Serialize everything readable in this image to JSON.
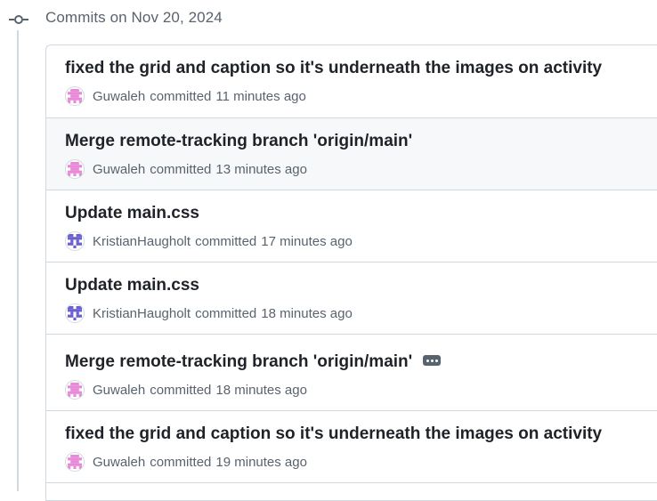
{
  "group": {
    "date_label": "Commits on Nov 20, 2024"
  },
  "colors": {
    "guwaleh_avatar": "#e88ad8",
    "kristian_avatar": "#6a60d0",
    "muted": "#59636e",
    "border": "#d1d9e0"
  },
  "commits": [
    {
      "title": "fixed the grid and caption so it's underneath the images on activity",
      "author": "Guwaleh",
      "action": "committed",
      "time": "11 minutes ago",
      "avatar_icon": "guwaleh-identicon",
      "has_ellipsis": false
    },
    {
      "title": "Merge remote-tracking branch 'origin/main'",
      "author": "Guwaleh",
      "action": "committed",
      "time": "13 minutes ago",
      "avatar_icon": "guwaleh-identicon",
      "has_ellipsis": false
    },
    {
      "title": "Update main.css",
      "author": "KristianHaugholt",
      "action": "committed",
      "time": "17 minutes ago",
      "avatar_icon": "kristian-identicon",
      "has_ellipsis": false
    },
    {
      "title": "Update main.css",
      "author": "KristianHaugholt",
      "action": "committed",
      "time": "18 minutes ago",
      "avatar_icon": "kristian-identicon",
      "has_ellipsis": false
    },
    {
      "title": "Merge remote-tracking branch 'origin/main'",
      "author": "Guwaleh",
      "action": "committed",
      "time": "18 minutes ago",
      "avatar_icon": "guwaleh-identicon",
      "has_ellipsis": true
    },
    {
      "title": "fixed the grid and caption so it's underneath the images on activity",
      "author": "Guwaleh",
      "action": "committed",
      "time": "19 minutes ago",
      "avatar_icon": "guwaleh-identicon",
      "has_ellipsis": false
    }
  ]
}
